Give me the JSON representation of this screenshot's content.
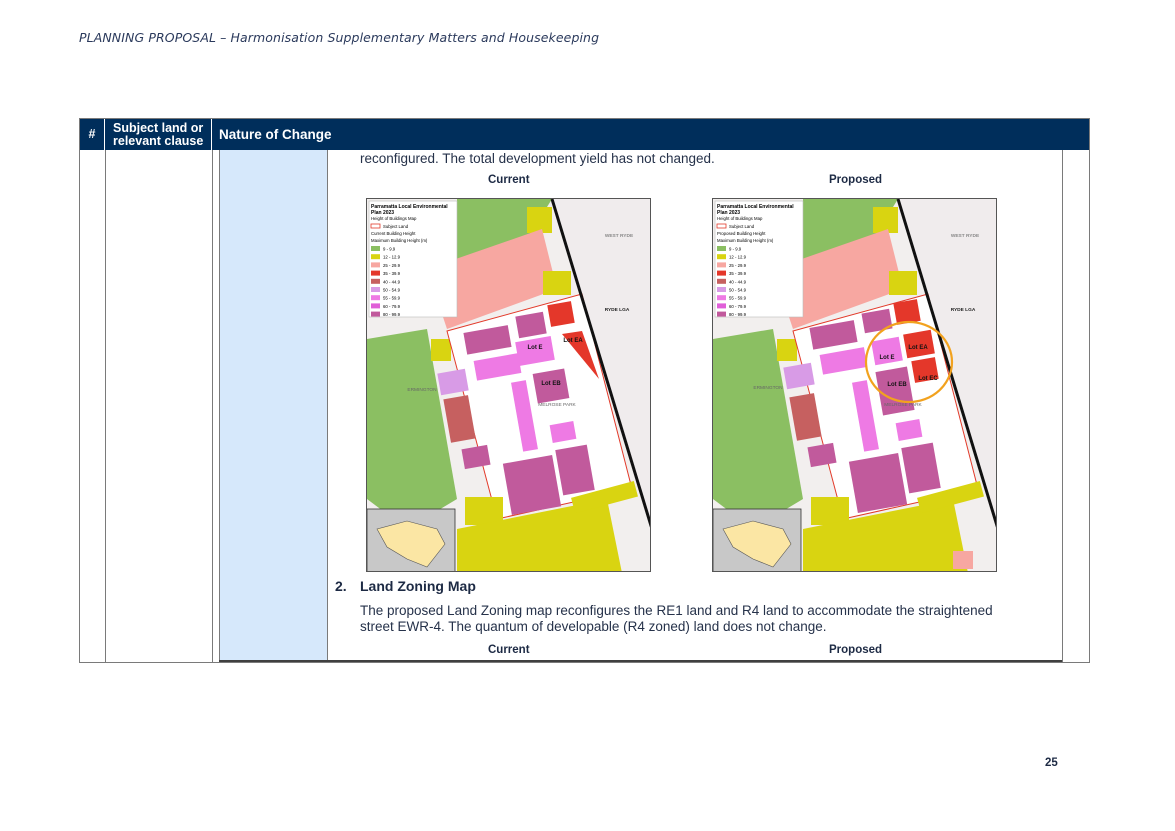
{
  "header": {
    "title": "PLANNING PROPOSAL – Harmonisation Supplementary Matters and Housekeeping"
  },
  "table": {
    "col_num": "#",
    "col_subject_line1": "Subject land or",
    "col_subject_line2": "relevant clause",
    "col_nature": "Nature of Change"
  },
  "content": {
    "intro_line": "reconfigured. The total development yield has not changed.",
    "label_current": "Current",
    "label_proposed": "Proposed",
    "section2_number": "2.",
    "section2_title": "Land Zoning Map",
    "section2_line1": "The proposed Land Zoning map reconfigures the RE1 land and R4 land to accommodate the straightened",
    "section2_line2": "street EWR-4. The quantum of developable (R4 zoned) land does not change.",
    "label_current_2": "Current",
    "label_proposed_2": "Proposed"
  },
  "maps": {
    "current": {
      "legend_title1": "Parramatta Local Environmental",
      "legend_title2": "Plan 2023",
      "legend_sub": "Height of Buildings Map",
      "legend_subject": "Subject Land",
      "legend_heading": "Current Building Height",
      "legend_heading2": "Maximum Building Height (m)",
      "lot_e": "Lot E",
      "lot_ea": "Lot EA",
      "lot_eb": "Lot EB",
      "west_ryde": "WEST RYDE",
      "ryde_lga": "RYDE LGA",
      "ermington": "ERMINGTON",
      "melrose": "MELROSE PARK"
    },
    "proposed": {
      "legend_title1": "Parramatta Local Environmental",
      "legend_title2": "Plan 2023",
      "legend_sub": "Height of Buildings Map",
      "legend_subject": "Subject Land",
      "legend_heading": "Proposed Building Height",
      "legend_heading2": "Maximum Building Height (m)",
      "lot_e": "Lot E",
      "lot_ea": "Lot EA",
      "lot_eb": "Lot EB",
      "lot_ec": "Lot EC",
      "west_ryde": "WEST RYDE",
      "ryde_lga": "RYDE LGA",
      "ermington": "ERMINGTON",
      "melrose": "MELROSE PARK"
    },
    "legend_ranges": [
      "9 - 9.9",
      "12 - 12.9",
      "25 - 29.9",
      "35 - 39.9",
      "40 - 44.9",
      "50 - 54.9",
      "55 - 59.9",
      "60 - 79.9",
      "80 - 99.9"
    ],
    "legend_colors": [
      "#8bbf62",
      "#d9d411",
      "#f7a7a1",
      "#e4372a",
      "#c66060",
      "#d89be6",
      "#ee7ae4",
      "#e05fd8",
      "#c15a9c"
    ]
  },
  "page": {
    "number": "25"
  }
}
